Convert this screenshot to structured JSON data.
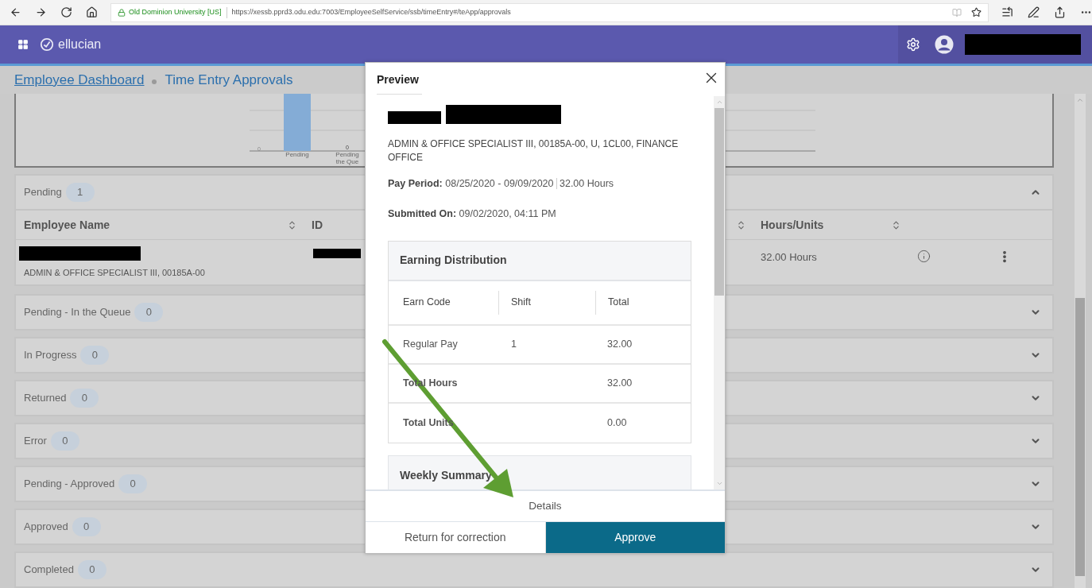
{
  "browser": {
    "site_identity": "Old Dominion University [US]",
    "url": "https://xessb.pprd3.odu.edu:7003/EmployeeSelfService/ssb/timeEntry#/teApp/approvals"
  },
  "header": {
    "brand": "ellucian"
  },
  "breadcrumbs": [
    {
      "label": "Employee Dashboard",
      "kind": "link"
    },
    {
      "label": "Time Entry Approvals",
      "kind": "current"
    }
  ],
  "chart": {
    "zero_tick": "0",
    "bars": [
      {
        "label_lines": [
          "Pending"
        ],
        "kind": "filled"
      },
      {
        "label_lines": [
          "Pending",
          "the Que"
        ],
        "value_label": "0",
        "kind": "empty"
      }
    ]
  },
  "sections": [
    {
      "title": "Pending",
      "count": "1",
      "expanded": true,
      "table": {
        "columns": [
          {
            "label": "Employee Name",
            "sortable": true
          },
          {
            "label": "ID",
            "sortable": false
          },
          {
            "sortable": true
          },
          {
            "label": "Hours/Units",
            "sortable": true
          }
        ],
        "rows": [
          {
            "job": "ADMIN & OFFICE SPECIALIST III, 00185A-00",
            "hours": "32.00 Hours"
          }
        ]
      }
    },
    {
      "title": "Pending - In the Queue",
      "count": "0",
      "expanded": false
    },
    {
      "title": "In Progress",
      "count": "0",
      "expanded": false
    },
    {
      "title": "Returned",
      "count": "0",
      "expanded": false
    },
    {
      "title": "Error",
      "count": "0",
      "expanded": false
    },
    {
      "title": "Pending - Approved",
      "count": "0",
      "expanded": false
    },
    {
      "title": "Approved",
      "count": "0",
      "expanded": false
    },
    {
      "title": "Completed",
      "count": "0",
      "expanded": false
    }
  ],
  "preview": {
    "title": "Preview",
    "position": "ADMIN & OFFICE SPECIALIST III, 00185A-00, U, 1CL00, FINANCE OFFICE",
    "pay_period": {
      "label": "Pay Period:",
      "value": "08/25/2020 - 09/09/2020",
      "hours": "32.00 Hours"
    },
    "submitted": {
      "label": "Submitted On:",
      "value": "09/02/2020, 04:11 PM"
    },
    "earning_distribution": {
      "title": "Earning Distribution",
      "columns": [
        "Earn Code",
        "Shift",
        "Total"
      ],
      "rows": [
        {
          "kind": "entry",
          "label": "Regular Pay",
          "shift": "1",
          "total": "32.00"
        },
        {
          "kind": "total",
          "label": "Total Hours",
          "total": "32.00"
        },
        {
          "kind": "total",
          "label": "Total Units",
          "total": "0.00"
        }
      ]
    },
    "weekly_summary": {
      "title": "Weekly Summary"
    },
    "details_button": "Details",
    "actions": [
      {
        "label": "Return for correction",
        "kind": "secondary"
      },
      {
        "label": "Approve",
        "kind": "primary"
      }
    ]
  }
}
